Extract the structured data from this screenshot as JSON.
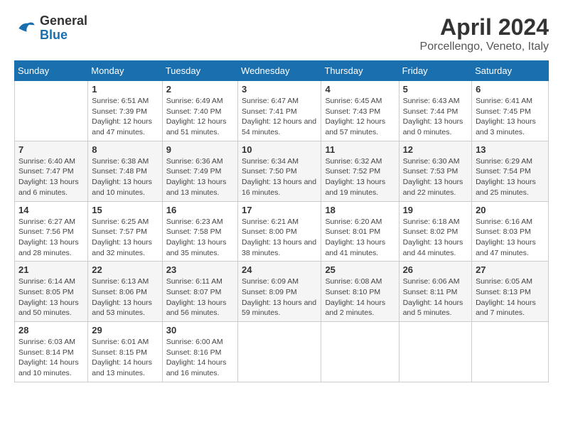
{
  "logo": {
    "general": "General",
    "blue": "Blue"
  },
  "title": "April 2024",
  "subtitle": "Porcellengo, Veneto, Italy",
  "headers": [
    "Sunday",
    "Monday",
    "Tuesday",
    "Wednesday",
    "Thursday",
    "Friday",
    "Saturday"
  ],
  "weeks": [
    [
      {
        "day": "",
        "sunrise": "",
        "sunset": "",
        "daylight": ""
      },
      {
        "day": "1",
        "sunrise": "Sunrise: 6:51 AM",
        "sunset": "Sunset: 7:39 PM",
        "daylight": "Daylight: 12 hours and 47 minutes."
      },
      {
        "day": "2",
        "sunrise": "Sunrise: 6:49 AM",
        "sunset": "Sunset: 7:40 PM",
        "daylight": "Daylight: 12 hours and 51 minutes."
      },
      {
        "day": "3",
        "sunrise": "Sunrise: 6:47 AM",
        "sunset": "Sunset: 7:41 PM",
        "daylight": "Daylight: 12 hours and 54 minutes."
      },
      {
        "day": "4",
        "sunrise": "Sunrise: 6:45 AM",
        "sunset": "Sunset: 7:43 PM",
        "daylight": "Daylight: 12 hours and 57 minutes."
      },
      {
        "day": "5",
        "sunrise": "Sunrise: 6:43 AM",
        "sunset": "Sunset: 7:44 PM",
        "daylight": "Daylight: 13 hours and 0 minutes."
      },
      {
        "day": "6",
        "sunrise": "Sunrise: 6:41 AM",
        "sunset": "Sunset: 7:45 PM",
        "daylight": "Daylight: 13 hours and 3 minutes."
      }
    ],
    [
      {
        "day": "7",
        "sunrise": "Sunrise: 6:40 AM",
        "sunset": "Sunset: 7:47 PM",
        "daylight": "Daylight: 13 hours and 6 minutes."
      },
      {
        "day": "8",
        "sunrise": "Sunrise: 6:38 AM",
        "sunset": "Sunset: 7:48 PM",
        "daylight": "Daylight: 13 hours and 10 minutes."
      },
      {
        "day": "9",
        "sunrise": "Sunrise: 6:36 AM",
        "sunset": "Sunset: 7:49 PM",
        "daylight": "Daylight: 13 hours and 13 minutes."
      },
      {
        "day": "10",
        "sunrise": "Sunrise: 6:34 AM",
        "sunset": "Sunset: 7:50 PM",
        "daylight": "Daylight: 13 hours and 16 minutes."
      },
      {
        "day": "11",
        "sunrise": "Sunrise: 6:32 AM",
        "sunset": "Sunset: 7:52 PM",
        "daylight": "Daylight: 13 hours and 19 minutes."
      },
      {
        "day": "12",
        "sunrise": "Sunrise: 6:30 AM",
        "sunset": "Sunset: 7:53 PM",
        "daylight": "Daylight: 13 hours and 22 minutes."
      },
      {
        "day": "13",
        "sunrise": "Sunrise: 6:29 AM",
        "sunset": "Sunset: 7:54 PM",
        "daylight": "Daylight: 13 hours and 25 minutes."
      }
    ],
    [
      {
        "day": "14",
        "sunrise": "Sunrise: 6:27 AM",
        "sunset": "Sunset: 7:56 PM",
        "daylight": "Daylight: 13 hours and 28 minutes."
      },
      {
        "day": "15",
        "sunrise": "Sunrise: 6:25 AM",
        "sunset": "Sunset: 7:57 PM",
        "daylight": "Daylight: 13 hours and 32 minutes."
      },
      {
        "day": "16",
        "sunrise": "Sunrise: 6:23 AM",
        "sunset": "Sunset: 7:58 PM",
        "daylight": "Daylight: 13 hours and 35 minutes."
      },
      {
        "day": "17",
        "sunrise": "Sunrise: 6:21 AM",
        "sunset": "Sunset: 8:00 PM",
        "daylight": "Daylight: 13 hours and 38 minutes."
      },
      {
        "day": "18",
        "sunrise": "Sunrise: 6:20 AM",
        "sunset": "Sunset: 8:01 PM",
        "daylight": "Daylight: 13 hours and 41 minutes."
      },
      {
        "day": "19",
        "sunrise": "Sunrise: 6:18 AM",
        "sunset": "Sunset: 8:02 PM",
        "daylight": "Daylight: 13 hours and 44 minutes."
      },
      {
        "day": "20",
        "sunrise": "Sunrise: 6:16 AM",
        "sunset": "Sunset: 8:03 PM",
        "daylight": "Daylight: 13 hours and 47 minutes."
      }
    ],
    [
      {
        "day": "21",
        "sunrise": "Sunrise: 6:14 AM",
        "sunset": "Sunset: 8:05 PM",
        "daylight": "Daylight: 13 hours and 50 minutes."
      },
      {
        "day": "22",
        "sunrise": "Sunrise: 6:13 AM",
        "sunset": "Sunset: 8:06 PM",
        "daylight": "Daylight: 13 hours and 53 minutes."
      },
      {
        "day": "23",
        "sunrise": "Sunrise: 6:11 AM",
        "sunset": "Sunset: 8:07 PM",
        "daylight": "Daylight: 13 hours and 56 minutes."
      },
      {
        "day": "24",
        "sunrise": "Sunrise: 6:09 AM",
        "sunset": "Sunset: 8:09 PM",
        "daylight": "Daylight: 13 hours and 59 minutes."
      },
      {
        "day": "25",
        "sunrise": "Sunrise: 6:08 AM",
        "sunset": "Sunset: 8:10 PM",
        "daylight": "Daylight: 14 hours and 2 minutes."
      },
      {
        "day": "26",
        "sunrise": "Sunrise: 6:06 AM",
        "sunset": "Sunset: 8:11 PM",
        "daylight": "Daylight: 14 hours and 5 minutes."
      },
      {
        "day": "27",
        "sunrise": "Sunrise: 6:05 AM",
        "sunset": "Sunset: 8:13 PM",
        "daylight": "Daylight: 14 hours and 7 minutes."
      }
    ],
    [
      {
        "day": "28",
        "sunrise": "Sunrise: 6:03 AM",
        "sunset": "Sunset: 8:14 PM",
        "daylight": "Daylight: 14 hours and 10 minutes."
      },
      {
        "day": "29",
        "sunrise": "Sunrise: 6:01 AM",
        "sunset": "Sunset: 8:15 PM",
        "daylight": "Daylight: 14 hours and 13 minutes."
      },
      {
        "day": "30",
        "sunrise": "Sunrise: 6:00 AM",
        "sunset": "Sunset: 8:16 PM",
        "daylight": "Daylight: 14 hours and 16 minutes."
      },
      {
        "day": "",
        "sunrise": "",
        "sunset": "",
        "daylight": ""
      },
      {
        "day": "",
        "sunrise": "",
        "sunset": "",
        "daylight": ""
      },
      {
        "day": "",
        "sunrise": "",
        "sunset": "",
        "daylight": ""
      },
      {
        "day": "",
        "sunrise": "",
        "sunset": "",
        "daylight": ""
      }
    ]
  ]
}
